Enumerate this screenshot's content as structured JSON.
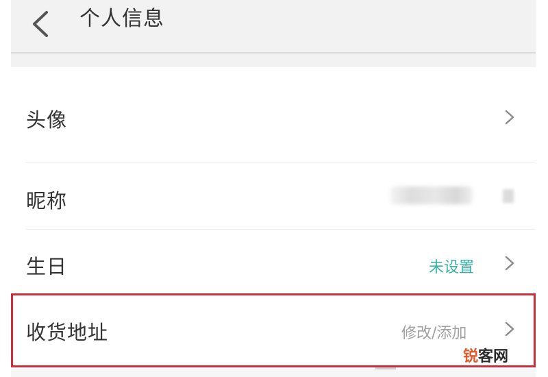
{
  "header": {
    "title": "个人信息",
    "back_icon": "chevron-left-icon"
  },
  "rows": [
    {
      "label": "头像",
      "value": "",
      "chevron": true
    },
    {
      "label": "昵称",
      "value": "",
      "chevron": false
    },
    {
      "label": "生日",
      "value": "未设置",
      "chevron": true
    },
    {
      "label": "收货地址",
      "value": "修改/添加",
      "chevron": true
    }
  ],
  "watermark": {
    "part1": "锐",
    "part2": "客网"
  },
  "colors": {
    "header_bg": "#f2f2f2",
    "label_text": "#333333",
    "unset_value": "#37b3a5",
    "secondary_value": "#a0a0a0",
    "chevron": "#8a8a8a",
    "highlight_border": "#cc2f3a",
    "watermark_accent": "#e2592b"
  }
}
